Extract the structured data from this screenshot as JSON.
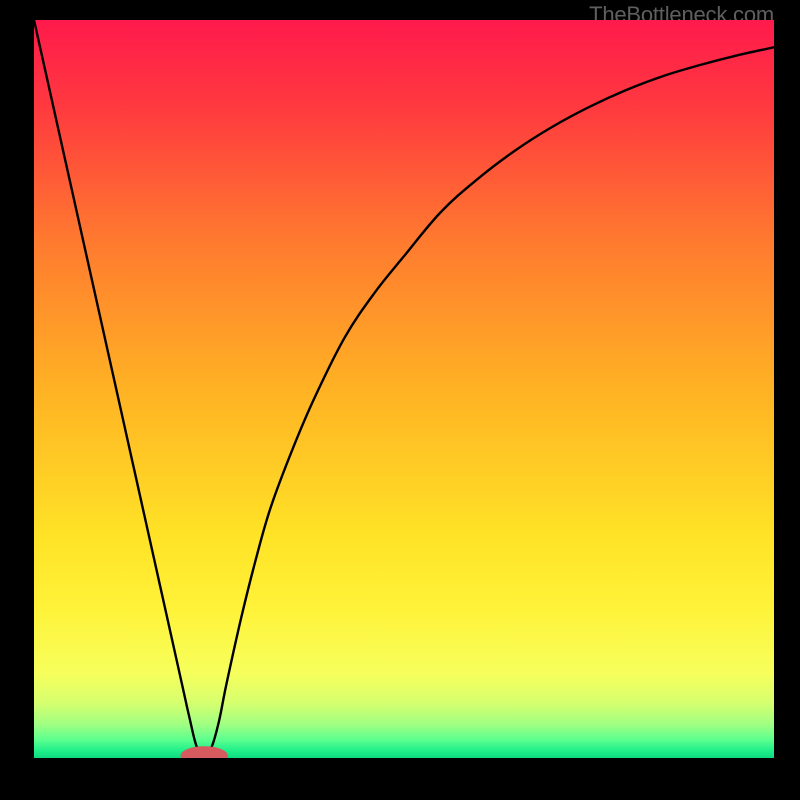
{
  "watermark": "TheBottleneck.com",
  "chart_data": {
    "type": "line",
    "title": "",
    "xlabel": "",
    "ylabel": "",
    "xlim": [
      0,
      100
    ],
    "ylim": [
      0,
      100
    ],
    "background_gradient": {
      "stops": [
        {
          "offset": 0.0,
          "color": "#ff1a4c"
        },
        {
          "offset": 0.12,
          "color": "#ff3a3f"
        },
        {
          "offset": 0.3,
          "color": "#ff7a2f"
        },
        {
          "offset": 0.5,
          "color": "#ffb224"
        },
        {
          "offset": 0.7,
          "color": "#ffe326"
        },
        {
          "offset": 0.8,
          "color": "#fff33a"
        },
        {
          "offset": 0.885,
          "color": "#f7ff5c"
        },
        {
          "offset": 0.925,
          "color": "#d6ff6e"
        },
        {
          "offset": 0.955,
          "color": "#9fff82"
        },
        {
          "offset": 0.975,
          "color": "#5dff8f"
        },
        {
          "offset": 0.99,
          "color": "#20ef8a"
        },
        {
          "offset": 1.0,
          "color": "#0fd97f"
        }
      ]
    },
    "series": [
      {
        "name": "bottleneck-curve",
        "color": "#000000",
        "x": [
          0,
          2,
          4,
          6,
          8,
          10,
          12,
          14,
          16,
          18,
          20,
          21,
          22,
          23,
          24,
          25,
          26,
          28,
          30,
          32,
          35,
          38,
          42,
          46,
          50,
          55,
          60,
          65,
          70,
          75,
          80,
          85,
          90,
          95,
          100
        ],
        "y": [
          100,
          91,
          82,
          73,
          64,
          55,
          46,
          37,
          28,
          19,
          10,
          5.5,
          1.5,
          0.5,
          1.5,
          5,
          10,
          19,
          27,
          34,
          42,
          49,
          57,
          63,
          68,
          74,
          78.5,
          82.3,
          85.5,
          88.2,
          90.5,
          92.4,
          93.9,
          95.2,
          96.3
        ]
      }
    ],
    "marker": {
      "name": "optimal-point",
      "x": 23,
      "y": 0.3,
      "color": "#d65a5e",
      "rx": 3.2,
      "ry": 1.3
    }
  }
}
